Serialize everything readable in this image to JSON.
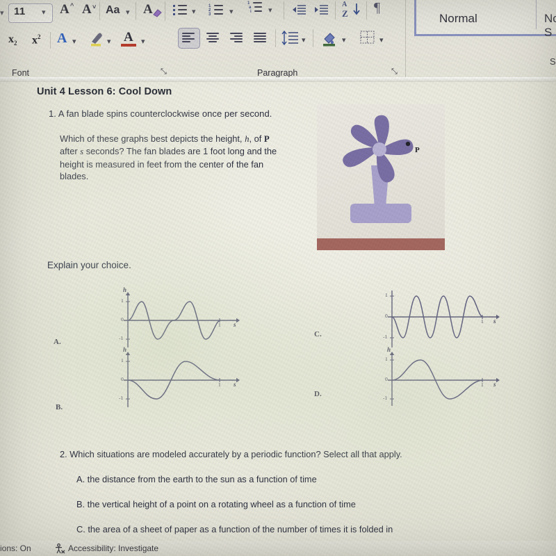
{
  "app": {
    "name": "Microsoft Word",
    "ribbon": {
      "font_group": {
        "label": "Font",
        "font_size_value": "11",
        "font_size_chevron": "chevron-down-icon",
        "grow_font_label": "A",
        "shrink_font_label": "A",
        "change_case_label": "Aa",
        "clear_formatting_label": "A",
        "subscript_label": "x",
        "subscript_sub": "2",
        "superscript_label": "x",
        "superscript_sup": "2",
        "text_effects_label": "A",
        "highlight_label": "highlight-icon",
        "font_color_label": "A",
        "dialog_launcher": "⤡"
      },
      "paragraph_group": {
        "label": "Paragraph",
        "bullets_icon": "bullet-list-icon",
        "numbering_icon": "numbered-list-icon",
        "multilevel_icon": "multilevel-list-icon",
        "decrease_indent_icon": "decrease-indent-icon",
        "increase_indent_icon": "increase-indent-icon",
        "sort_icon": "sort-az-icon",
        "formatting_marks_icon": "pilcrow-icon",
        "align_left_icon": "align-left-icon",
        "align_center_icon": "align-center-icon",
        "align_right_icon": "align-right-icon",
        "justify_icon": "justify-icon",
        "line_spacing_icon": "line-spacing-icon",
        "shading_icon": "shading-icon",
        "borders_icon": "borders-icon",
        "dialog_launcher": "⤡"
      },
      "styles_group": {
        "label": "S",
        "selected_style": "Normal",
        "next_style": "No S"
      }
    },
    "status_bar": {
      "left_text": "ions: On",
      "accessibility_icon": "accessibility-icon",
      "accessibility_text": "Accessibility: Investigate"
    }
  },
  "document": {
    "title": "Unit 4 Lesson 6: Cool Down",
    "q1": {
      "number": "1. A fan blade spins counterclockwise once per second.",
      "body_line1_a": "Which of these graphs best depicts the height, ",
      "body_h": "h",
      "body_line1_b": ", of ",
      "body_P": "P",
      "body_line2_a": "after ",
      "body_s": "s",
      "body_line2_b": " seconds? The fan blades are 1 foot long and the",
      "body_line3": "height is measured in feet from the center of the fan",
      "body_line4": "blades.",
      "figure": {
        "name": "fan-illustration",
        "point_label": "P",
        "blade_color": "#7a6fa8",
        "hub_color": "#b9b3d8",
        "stand_color": "#a9a2cf",
        "base_color": "#a8675f"
      },
      "explain_prompt": "Explain your choice."
    },
    "q2": {
      "number": "2. Which situations are modeled accurately by a periodic function? Select all that apply.",
      "options": [
        "A. the distance from the earth to the sun as a function of time",
        "B. the vertical height of a point on a rotating wheel as a function of time",
        "C. the area of a sheet of paper as a function of the number of times it is folded in"
      ]
    }
  },
  "chart_data": [
    {
      "id": "graph-a",
      "type": "line",
      "label": "A.",
      "title": "",
      "xlabel": "s",
      "ylabel": "h",
      "xlim": [
        0,
        2.3
      ],
      "ylim": [
        -1.4,
        1.4
      ],
      "xticks": [
        "1",
        "s"
      ],
      "yticks": [
        "1",
        "0",
        "-1"
      ],
      "grid": false,
      "function": "sin(2*pi*2*s)",
      "periods": 2,
      "amplitude": 1,
      "phase": "starts-at-zero-rising"
    },
    {
      "id": "graph-b",
      "type": "line",
      "label": "B.",
      "title": "",
      "xlabel": "s",
      "ylabel": "h",
      "xlim": [
        0,
        2.3
      ],
      "ylim": [
        -1.4,
        1.4
      ],
      "xticks": [
        "1",
        "s"
      ],
      "yticks": [
        "1",
        "0",
        "-1"
      ],
      "grid": false,
      "function": "-sin(2*pi*s)",
      "periods": 1,
      "amplitude": 1,
      "phase": "starts-at-zero-falling"
    },
    {
      "id": "graph-c",
      "type": "line",
      "label": "C.",
      "title": "",
      "xlabel": "s",
      "ylabel": "h",
      "xlim": [
        0,
        2.3
      ],
      "ylim": [
        -1.4,
        1.4
      ],
      "xticks": [
        "1",
        "s"
      ],
      "yticks": [
        "1",
        "0",
        "-1"
      ],
      "grid": false,
      "function": "-sin(2*pi*2.5*s)",
      "periods": 2.5,
      "amplitude": 1,
      "phase": "starts-at-zero-falling"
    },
    {
      "id": "graph-d",
      "type": "line",
      "label": "D.",
      "title": "",
      "xlabel": "s",
      "ylabel": "h",
      "xlim": [
        0,
        2.3
      ],
      "ylim": [
        -1.4,
        1.4
      ],
      "xticks": [
        "1",
        "s"
      ],
      "yticks": [
        "1",
        "0",
        "-1"
      ],
      "grid": false,
      "function": "sin(2*pi*s)",
      "periods": 1,
      "amplitude": 1,
      "phase": "starts-at-zero-rising"
    }
  ]
}
